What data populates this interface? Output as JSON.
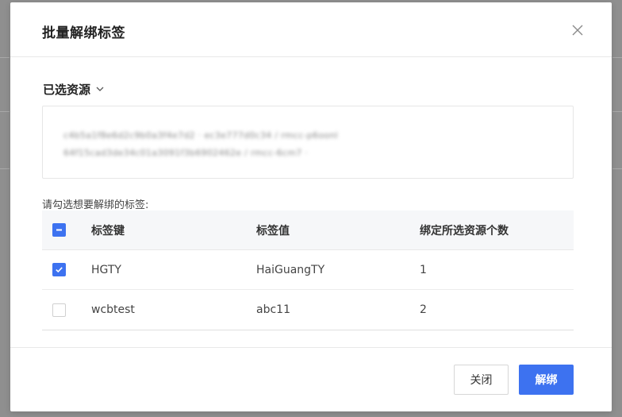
{
  "modal": {
    "title": "批量解绑标签",
    "close_icon": "close-icon"
  },
  "selected_resources": {
    "label": "已选资源",
    "toggle_icon": "chevron-down-icon",
    "items": [
      "c4b5a1f8e6d2c9b0a3f4e7d2 · ec3e777d0c34 / rmcc-p6oonl",
      "64f15cad3de34c01a3091f3b6902462e / rmcc-6cm7 · "
    ]
  },
  "instruction": "请勾选想要解绑的标签:",
  "table": {
    "header": {
      "select_all_state": "indeterminate",
      "key": "标签键",
      "value": "标签值",
      "count": "绑定所选资源个数"
    },
    "rows": [
      {
        "checked": true,
        "key": "HGTY",
        "value": "HaiGuangTY",
        "count": "1"
      },
      {
        "checked": false,
        "key": "wcbtest",
        "value": "abc11",
        "count": "2"
      }
    ]
  },
  "footer": {
    "close_label": "关闭",
    "confirm_label": "解绑"
  },
  "colors": {
    "primary": "#3d72f0",
    "backdrop": "#8f8f8f"
  }
}
